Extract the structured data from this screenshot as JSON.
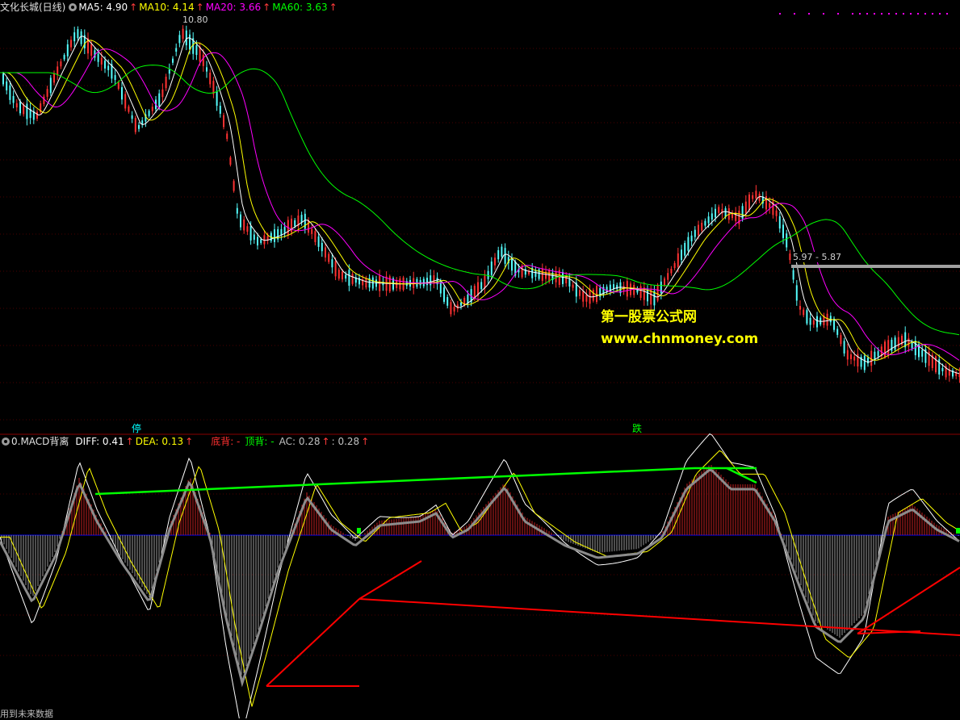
{
  "price_header": {
    "title": "文化长城(日线)",
    "ma5": "MA5: 4.90",
    "ma10": "MA10: 4.14",
    "ma20": "MA20: 3.66",
    "ma60": "MA60: 3.63",
    "arrow": "↑"
  },
  "macd_header": {
    "title": "0.MACD背离",
    "diff": "DIFF: 0.41",
    "dea": "DEA: 0.13",
    "bottom_div": "底背: -",
    "top_div": "顶背: -",
    "ac": "AC: 0.28",
    "extra": ": 0.28",
    "arrow": "↑"
  },
  "annotations": {
    "peak_label": "10.80",
    "range_label": "5.97 - 5.87",
    "halt_tag": "停",
    "drop_tag": "跌",
    "footer": "用到未来数据"
  },
  "watermark": {
    "cn": "第一股票公式网",
    "url": "www.chnmoney.com"
  },
  "colors": {
    "ma5": "#ffffff",
    "ma10": "#ffff00",
    "ma20": "#ff00ff",
    "ma60": "#00ff00",
    "up_candle": "#ff3232",
    "down_candle": "#54fcfc",
    "divergence_top": "#00ff00",
    "divergence_bottom": "#ff0000",
    "zero_axis": "#0000ff"
  }
}
